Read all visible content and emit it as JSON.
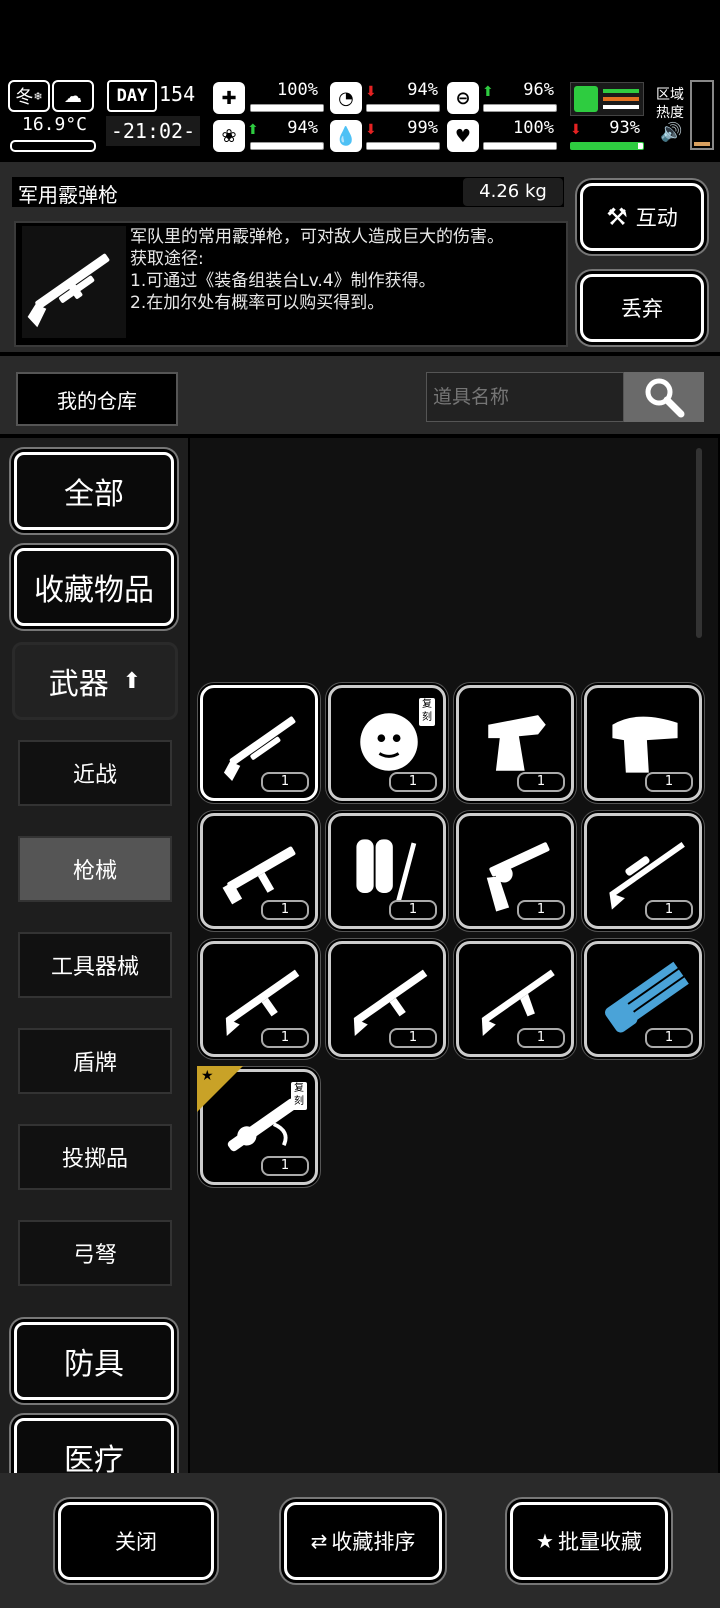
{
  "status": {
    "season": "冬",
    "temperature": "16.9°C",
    "day_label": "DAY",
    "day_number": "154",
    "time": "-21:02-",
    "stats": [
      {
        "name": "health",
        "value": "100%",
        "trend": "none",
        "level": 1.0
      },
      {
        "name": "hunger",
        "value": "94%",
        "trend": "down",
        "level": 0.94
      },
      {
        "name": "thirst-mood",
        "value": "96%",
        "trend": "up",
        "level": 0.96
      },
      {
        "name": "sanity",
        "value": "94%",
        "trend": "up",
        "level": 0.94
      },
      {
        "name": "water",
        "value": "99%",
        "trend": "down",
        "level": 0.99
      },
      {
        "name": "heart",
        "value": "100%",
        "trend": "none",
        "level": 1.0
      },
      {
        "name": "stamina",
        "value": "93%",
        "trend": "down",
        "level": 0.93
      }
    ],
    "zone_heat_label": "区域\n热度"
  },
  "item": {
    "name": "军用霰弹枪",
    "weight": "4.26 kg",
    "description": "军队里的常用霰弹枪，可对敌人造成巨大的伤害。\n获取途径:\n1.可通过《装备组装台Lv.4》制作获得。\n2.在加尔处有概率可以购买得到。"
  },
  "actions": {
    "interact": "互动",
    "discard": "丢弃"
  },
  "warehouse": {
    "label": "我的仓库",
    "search_placeholder": "道具名称"
  },
  "categories": {
    "all": "全部",
    "favorites": "收藏物品",
    "weapons": "武器",
    "sub": [
      "近战",
      "枪械",
      "工具器械",
      "盾牌",
      "投掷品",
      "弓弩"
    ],
    "armor": "防具",
    "medical": "医疗"
  },
  "grid_items": [
    {
      "icon": "shotgun-icon",
      "count": "1",
      "selected": true
    },
    {
      "icon": "medusa-icon",
      "count": "1",
      "copy": "复刻"
    },
    {
      "icon": "flamethrower-icon",
      "count": "1"
    },
    {
      "icon": "blaster-icon",
      "count": "1"
    },
    {
      "icon": "smg-icon",
      "count": "1"
    },
    {
      "icon": "flame-tank-icon",
      "count": "1"
    },
    {
      "icon": "revolver-icon",
      "count": "1"
    },
    {
      "icon": "sniper-rifle-icon",
      "count": "1"
    },
    {
      "icon": "assault-rifle-icon",
      "count": "1"
    },
    {
      "icon": "assault-rifle-icon",
      "count": "1"
    },
    {
      "icon": "ak-rifle-icon",
      "count": "1"
    },
    {
      "icon": "minigun-icon",
      "count": "1"
    },
    {
      "icon": "ornate-gun-icon",
      "count": "1",
      "copy": "复刻",
      "starred": true
    }
  ],
  "bottom": {
    "close": "关闭",
    "sort_favorites": "收藏排序",
    "batch_favorite": "批量收藏"
  },
  "colors": {
    "panel": "#2a2a2a",
    "up": "#2ecc40",
    "down": "#e52222",
    "stamina_bar": "#2ecc40",
    "star_tag": "#c9a227",
    "minigun": "#4aa3d8"
  }
}
